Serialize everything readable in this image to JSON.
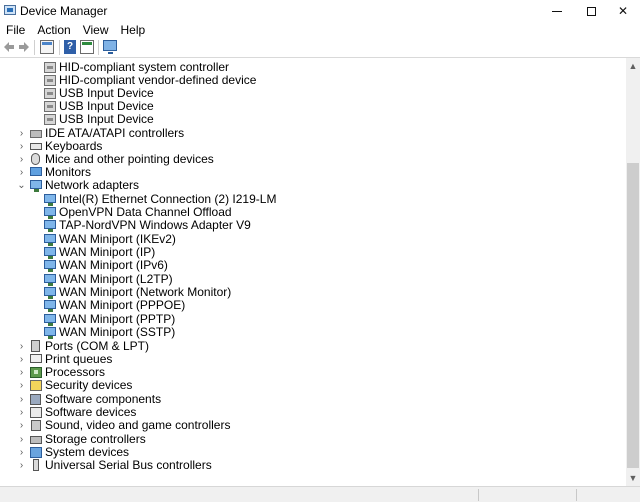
{
  "window": {
    "title": "Device Manager",
    "minimize_glyph": "—",
    "maximize_glyph": "☐",
    "close_glyph": "✕"
  },
  "menu": [
    "File",
    "Action",
    "View",
    "Help"
  ],
  "toolbar": {
    "help_glyph": "?",
    "icons": [
      "back-arrow-icon",
      "forward-arrow-icon",
      "properties-icon",
      "help-icon",
      "update-driver-icon",
      "scan-hardware-icon"
    ]
  },
  "tree": {
    "hid_children": [
      "HID-compliant system controller",
      "HID-compliant vendor-defined device",
      "USB Input Device",
      "USB Input Device",
      "USB Input Device"
    ],
    "categories_before": [
      "IDE ATA/ATAPI controllers",
      "Keyboards",
      "Mice and other pointing devices",
      "Monitors"
    ],
    "network_adapters": {
      "label": "Network adapters",
      "children": [
        "Intel(R) Ethernet Connection (2) I219-LM",
        "OpenVPN Data Channel Offload",
        "TAP-NordVPN Windows Adapter V9",
        "WAN Miniport (IKEv2)",
        "WAN Miniport (IP)",
        "WAN Miniport (IPv6)",
        "WAN Miniport (L2TP)",
        "WAN Miniport (Network Monitor)",
        "WAN Miniport (PPPOE)",
        "WAN Miniport (PPTP)",
        "WAN Miniport (SSTP)"
      ]
    },
    "categories_after": [
      "Ports (COM & LPT)",
      "Print queues",
      "Processors",
      "Security devices",
      "Software components",
      "Software devices",
      "Sound, video and game controllers",
      "Storage controllers",
      "System devices",
      "Universal Serial Bus controllers"
    ],
    "collapsed_chevron": "›",
    "expanded_chevron": "⌄"
  },
  "colors": {
    "accent": "#2d5e9c",
    "scroll_thumb": "#cdcdcd"
  }
}
